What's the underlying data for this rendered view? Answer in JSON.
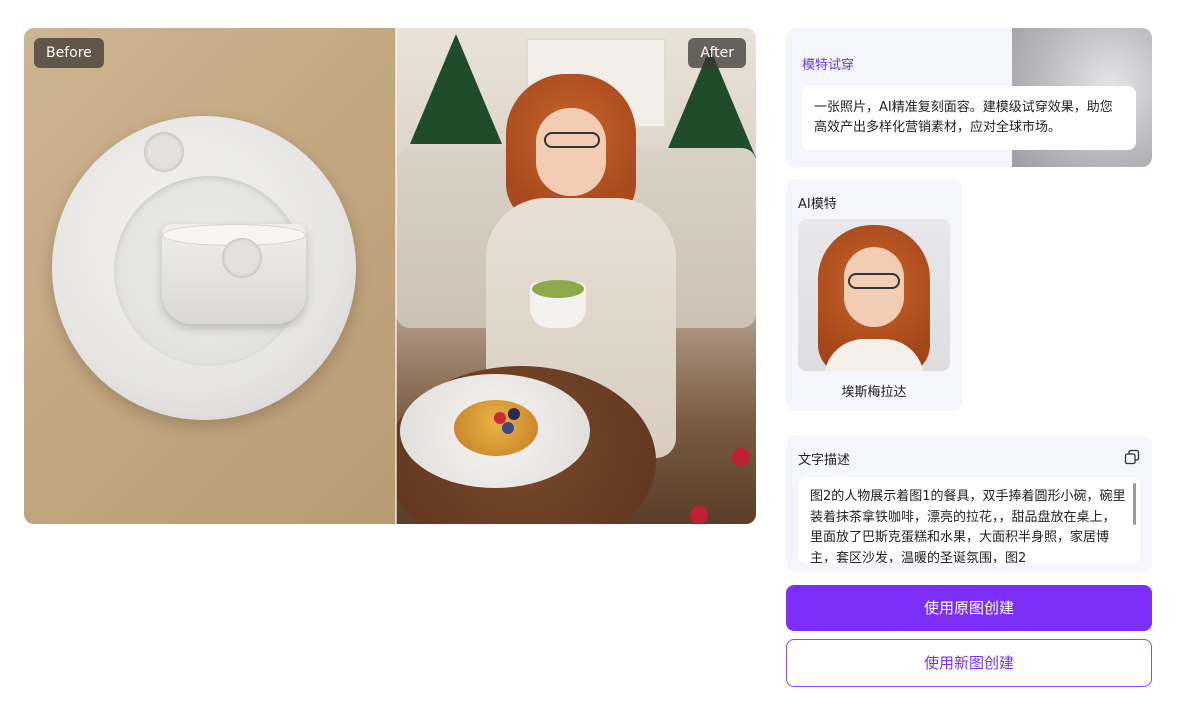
{
  "compare": {
    "before_label": "Before",
    "after_label": "After"
  },
  "tryon": {
    "title": "模特试穿",
    "description": "一张照片，AI精准复刻面容。建模级试穿效果，助您高效产出多样化营销素材，应对全球市场。"
  },
  "model": {
    "section_label": "AI模特",
    "name": "埃斯梅拉达"
  },
  "prompt": {
    "section_label": "文字描述",
    "copy_icon": "copy-icon",
    "text": "图2的人物展示着图1的餐具，双手捧着圆形小碗，碗里装着抹茶拿铁咖啡，漂亮的拉花，，甜品盘放在桌上，里面放了巴斯克蛋糕和水果，大面积半身照，家居博主，套区沙发，温暖的圣诞氛围，图2"
  },
  "actions": {
    "use_original": "使用原图创建",
    "use_new": "使用新图创建"
  },
  "colors": {
    "accent": "#7b2ff7",
    "card_bg": "#f5f6fb"
  }
}
